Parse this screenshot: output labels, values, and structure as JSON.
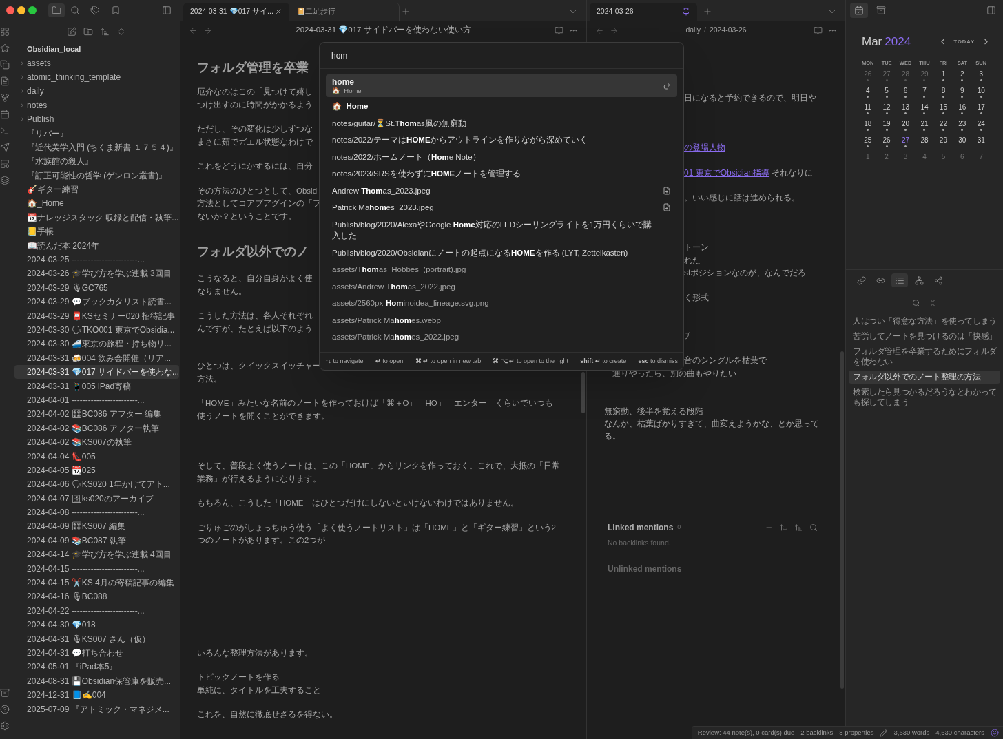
{
  "file_explorer": {
    "vault_name": "Obsidian_local",
    "items": [
      {
        "kind": "folder",
        "name": "assets",
        "selected": false
      },
      {
        "kind": "folder",
        "name": "atomic_thinking_template",
        "selected": false
      },
      {
        "kind": "folder",
        "name": "daily",
        "selected": false
      },
      {
        "kind": "folder",
        "name": "notes",
        "selected": false
      },
      {
        "kind": "folder",
        "name": "Publish",
        "selected": false
      },
      {
        "kind": "file",
        "name": "『リバー』",
        "selected": false
      },
      {
        "kind": "file",
        "name": "『近代美学入門 (ちくま新書 １７５４)』",
        "selected": false
      },
      {
        "kind": "file",
        "name": "『水族館の殺人』",
        "selected": false
      },
      {
        "kind": "file",
        "name": "『訂正可能性の哲学 (ゲンロン叢書)』",
        "selected": false
      },
      {
        "kind": "file",
        "name": "🎸ギター練習",
        "selected": false
      },
      {
        "kind": "file",
        "name": "🏠_Home",
        "selected": false
      },
      {
        "kind": "file",
        "name": "📆ナレッジスタック 収録と配信・執筆...",
        "selected": false
      },
      {
        "kind": "file",
        "name": "📒手帳",
        "selected": false
      },
      {
        "kind": "file",
        "name": "📖読んだ本 2024年",
        "selected": false
      },
      {
        "kind": "file",
        "name": "2024-03-25 ------------------------...",
        "selected": false
      },
      {
        "kind": "file",
        "name": "2024-03-26 🎓学び方を学ぶ連載 3回目",
        "selected": false
      },
      {
        "kind": "file",
        "name": "2024-03-29 🎙GC765",
        "selected": false
      },
      {
        "kind": "file",
        "name": "2024-03-29 💬ブックカタリスト読書...",
        "selected": false
      },
      {
        "kind": "file",
        "name": "2024-03-29 📮KSセミナー020 招待記事",
        "selected": false
      },
      {
        "kind": "file",
        "name": "2024-03-30 🗣TKO001 東京でObsidia...",
        "selected": false
      },
      {
        "kind": "file",
        "name": "2024-03-30 🚄東京の旅程・持ち物リ...",
        "selected": false
      },
      {
        "kind": "file",
        "name": "2024-03-31 🍻004 飲み会開催（リア...",
        "selected": false
      },
      {
        "kind": "file",
        "name": "2024-03-31 💎017 サイドバーを使わな...",
        "selected": true
      },
      {
        "kind": "file",
        "name": "2024-03-31 📱005 iPad寄稿",
        "selected": false
      },
      {
        "kind": "file",
        "name": "2024-04-01 ------------------------...",
        "selected": false
      },
      {
        "kind": "file",
        "name": "2024-04-02 🎛BC086 アフター 編集",
        "selected": false
      },
      {
        "kind": "file",
        "name": "2024-04-02 📚BC086 アフター執筆",
        "selected": false
      },
      {
        "kind": "file",
        "name": "2024-04-02 📚KS007の執筆",
        "selected": false
      },
      {
        "kind": "file",
        "name": "2024-04-04 👠005",
        "selected": false
      },
      {
        "kind": "file",
        "name": "2024-04-05 📆025",
        "selected": false
      },
      {
        "kind": "file",
        "name": "2024-04-06 🗣KS020 1年かけてアト...",
        "selected": false
      },
      {
        "kind": "file",
        "name": "2024-04-07 🗄ks020のアーカイブ",
        "selected": false
      },
      {
        "kind": "file",
        "name": "2024-04-08 ------------------------...",
        "selected": false
      },
      {
        "kind": "file",
        "name": "2024-04-09 🎛KS007 編集",
        "selected": false
      },
      {
        "kind": "file",
        "name": "2024-04-09 📚BC087 執筆",
        "selected": false
      },
      {
        "kind": "file",
        "name": "2024-04-14 🎓学び方を学ぶ連載 4回目",
        "selected": false
      },
      {
        "kind": "file",
        "name": "2024-04-15 ------------------------...",
        "selected": false
      },
      {
        "kind": "file",
        "name": "2024-04-15 ✂️KS 4月の寄稿記事の編集",
        "selected": false
      },
      {
        "kind": "file",
        "name": "2024-04-16 🎙BC088",
        "selected": false
      },
      {
        "kind": "file",
        "name": "2024-04-22 ------------------------...",
        "selected": false
      },
      {
        "kind": "file",
        "name": "2024-04-30 💎018",
        "selected": false
      },
      {
        "kind": "file",
        "name": "2024-04-31 🎙KS007 さん（仮）",
        "selected": false
      },
      {
        "kind": "file",
        "name": "2024-04-31 💬打ち合わせ",
        "selected": false
      },
      {
        "kind": "file",
        "name": "2024-05-01 『iPad本5』",
        "selected": false
      },
      {
        "kind": "file",
        "name": "2024-08-31 💾Obsidian保管庫を販売...",
        "selected": false
      },
      {
        "kind": "file",
        "name": "2024-12-31 📘✍️004",
        "selected": false
      },
      {
        "kind": "file",
        "name": "2025-07-09 『アトミック・マネジメ...",
        "selected": false
      }
    ]
  },
  "left_pane": {
    "tabs": [
      {
        "label": "2024-03-31 💎017 サイ...",
        "selected": true
      },
      {
        "label": "📔二足歩行",
        "selected": false
      }
    ],
    "title": "2024-03-31 💎017 サイドバーを使わない使い方",
    "content": [
      {
        "kind": "heading",
        "lines": [
          "フォルダ管理を卒業"
        ]
      },
      {
        "kind": "paragraph",
        "lines": [
          "厄介なのはこの「見つけて嬉し",
          "つけ出すのに時間がかかるよう"
        ]
      },
      {
        "kind": "paragraph",
        "lines": [
          "ただし、その変化は少しずつな",
          "まさに茹でガエル状態なわけで"
        ]
      },
      {
        "kind": "paragraph",
        "lines": [
          "これをどうにかするには、自分"
        ]
      },
      {
        "kind": "paragraph",
        "lines": [
          "その方法のひとつとして、Obsid",
          "方法としてコアプアグインの「フ",
          "ないか？ということです。"
        ]
      },
      {
        "kind": "heading",
        "lines": [
          "フォルダ以外でのノ"
        ]
      },
      {
        "kind": "paragraph",
        "lines": [
          "こうなると、自分自身がよく使",
          "なりません。"
        ]
      },
      {
        "kind": "paragraph",
        "lines": [
          "こうした方法は、各人それぞれ",
          "んですが、たとえば以下のよう"
        ]
      },
      {
        "kind": "paragraph",
        "lines": [
          "ひとつは、クイックスイッチャー",
          "方法。"
        ]
      },
      {
        "kind": "paragraph",
        "lines": [
          "「HOME」みたいな名前のノートを作っておけば「⌘＋O」「HO」「エンター」くらいでいつも",
          "使うノートを開くことができます。"
        ]
      },
      {
        "kind": "paragraph",
        "lines": [
          "そして、普段よく使うノートは、この「HOME」からリンクを作っておく。これで、大抵の「日常",
          "業務」が行えるようになります。"
        ]
      },
      {
        "kind": "paragraph",
        "lines": [
          "もちろん、こうした「HOME」はひとつだけにしないといけないわけではありません。"
        ]
      },
      {
        "kind": "paragraph",
        "lines": [
          "ごりゅごのがしょっちゅう使う「よく使うノートリスト」は「HOME」と「ギター練習」という2",
          "つのノートがあります。この2つが"
        ]
      },
      {
        "kind": "paragraph",
        "lines": [
          "いろんな整理方法があります。"
        ]
      },
      {
        "kind": "paragraph",
        "lines": [
          "トピックノートを作る",
          "単純に、タイトルを工夫すること"
        ]
      },
      {
        "kind": "paragraph",
        "lines": [
          "これを、自然に徹底せざるを得ない。"
        ]
      }
    ]
  },
  "right_pane": {
    "tabs": [
      {
        "label": "2024-03-26",
        "selected": true,
        "pinned": true
      }
    ],
    "breadcrumb": [
      "daily",
      "2024-03-26"
    ],
    "breadcrumb_separator": "/",
    "content": [
      {
        "kind": "fragment",
        "text": "日になると予約できるので、明日や"
      },
      {
        "kind": "fragment",
        "link": "の登場人物"
      },
      {
        "kind": "fragment",
        "link": "01 東京でObsidian指導",
        "text": " それなりに"
      },
      {
        "kind": "fragment",
        "text": "。いい感じに話は進められる。"
      },
      {
        "kind": "fragment",
        "text": "トーン"
      },
      {
        "kind": "fragment",
        "text": "れた"
      },
      {
        "kind": "fragment",
        "text": "stポジションなのが、なんでだろ"
      },
      {
        "kind": "fragment",
        "text": "く形式"
      },
      {
        "kind": "fragment",
        "text": "チ"
      },
      {
        "kind": "fragment",
        "text": "音のシングルを枯葉で"
      },
      {
        "kind": "line",
        "text": "一通りやったら、別の曲もやりたい"
      },
      {
        "kind": "line",
        "text": "無窮動、後半を覚える段階"
      },
      {
        "kind": "line",
        "text": "なんか、枯葉ばかりすぎて、曲変えようかな、とか思って"
      },
      {
        "kind": "line",
        "text": "る。"
      }
    ],
    "linked_mentions": {
      "title": "Linked mentions",
      "count": "0",
      "empty": "No backlinks found."
    },
    "unlinked_mentions": "Unlinked mentions"
  },
  "right_sidebar": {
    "calendar": {
      "month": "Mar",
      "year": "2024",
      "today_label": "TODAY",
      "weekdays": [
        "MON",
        "TUE",
        "WED",
        "THU",
        "FRI",
        "SAT",
        "SUN"
      ],
      "weeks": [
        [
          {
            "day": "26",
            "dim": true,
            "dot": true,
            "today": false
          },
          {
            "day": "27",
            "dim": true,
            "dot": true,
            "today": false
          },
          {
            "day": "28",
            "dim": true,
            "dot": true,
            "today": false
          },
          {
            "day": "29",
            "dim": true,
            "dot": true,
            "today": false
          },
          {
            "day": "1",
            "dim": false,
            "dot": true,
            "today": false
          },
          {
            "day": "2",
            "dim": false,
            "dot": true,
            "today": false
          },
          {
            "day": "3",
            "dim": false,
            "dot": true,
            "today": false
          }
        ],
        [
          {
            "day": "4",
            "dim": false,
            "dot": true,
            "today": false
          },
          {
            "day": "5",
            "dim": false,
            "dot": true,
            "today": false
          },
          {
            "day": "6",
            "dim": false,
            "dot": true,
            "today": false
          },
          {
            "day": "7",
            "dim": false,
            "dot": true,
            "today": false
          },
          {
            "day": "8",
            "dim": false,
            "dot": true,
            "today": false
          },
          {
            "day": "9",
            "dim": false,
            "dot": true,
            "today": false
          },
          {
            "day": "10",
            "dim": false,
            "dot": true,
            "today": false
          }
        ],
        [
          {
            "day": "11",
            "dim": false,
            "dot": true,
            "today": false
          },
          {
            "day": "12",
            "dim": false,
            "dot": true,
            "today": false
          },
          {
            "day": "13",
            "dim": false,
            "dot": true,
            "today": false
          },
          {
            "day": "14",
            "dim": false,
            "dot": true,
            "today": false
          },
          {
            "day": "15",
            "dim": false,
            "dot": true,
            "today": false
          },
          {
            "day": "16",
            "dim": false,
            "dot": true,
            "today": false
          },
          {
            "day": "17",
            "dim": false,
            "dot": true,
            "today": false
          }
        ],
        [
          {
            "day": "18",
            "dim": false,
            "dot": true,
            "today": false
          },
          {
            "day": "19",
            "dim": false,
            "dot": true,
            "today": false
          },
          {
            "day": "20",
            "dim": false,
            "dot": true,
            "today": false
          },
          {
            "day": "21",
            "dim": false,
            "dot": true,
            "today": false
          },
          {
            "day": "22",
            "dim": false,
            "dot": true,
            "today": false
          },
          {
            "day": "23",
            "dim": false,
            "dot": true,
            "today": false
          },
          {
            "day": "24",
            "dim": false,
            "dot": true,
            "today": false
          }
        ],
        [
          {
            "day": "25",
            "dim": false,
            "dot": true,
            "today": false
          },
          {
            "day": "26",
            "dim": false,
            "dot": true,
            "today": false
          },
          {
            "day": "27",
            "dim": false,
            "dot": true,
            "today": true
          },
          {
            "day": "28",
            "dim": false,
            "dot": false,
            "today": false
          },
          {
            "day": "29",
            "dim": false,
            "dot": false,
            "today": false
          },
          {
            "day": "30",
            "dim": false,
            "dot": false,
            "today": false
          },
          {
            "day": "31",
            "dim": false,
            "dot": false,
            "today": false
          }
        ],
        [
          {
            "day": "1",
            "dim": true,
            "dot": false,
            "today": false
          },
          {
            "day": "2",
            "dim": true,
            "dot": false,
            "today": false
          },
          {
            "day": "3",
            "dim": true,
            "dot": false,
            "today": false
          },
          {
            "day": "4",
            "dim": true,
            "dot": false,
            "today": false
          },
          {
            "day": "5",
            "dim": true,
            "dot": false,
            "today": false
          },
          {
            "day": "6",
            "dim": true,
            "dot": false,
            "today": false
          },
          {
            "day": "7",
            "dim": true,
            "dot": false,
            "today": false
          }
        ]
      ]
    },
    "panel_tabs": [
      {
        "kind": "backlinks",
        "selected": false
      },
      {
        "kind": "outgoing",
        "selected": false
      },
      {
        "kind": "outline",
        "selected": true
      },
      {
        "kind": "tree",
        "selected": false
      },
      {
        "kind": "graph",
        "selected": false
      }
    ],
    "outline": [
      {
        "text": "人はつい「得意な方法」を使ってしまう",
        "selected": false
      },
      {
        "text": "苦労してノートを見つけるのは「快感」",
        "selected": false
      },
      {
        "text": "フォルダ管理を卒業するためにフォルダを使わない",
        "selected": false
      },
      {
        "text": "フォルダ以外でのノート整理の方法",
        "selected": true
      },
      {
        "text": "検索したら見つかるだろうなとわかっても探してしまう",
        "selected": false
      }
    ]
  },
  "quick_switcher": {
    "query": "hom",
    "results": [
      {
        "kind": "alias",
        "text": "home",
        "sub": "🏠_Home",
        "selected": true
      },
      {
        "kind": "note",
        "text": "🏠_**Home**",
        "selected": false
      },
      {
        "kind": "note",
        "text": "notes/guitar/⏳St.**Thom**as風の無窮動",
        "selected": false
      },
      {
        "kind": "note",
        "text": "notes/2022/テーマは**HOME**からアウトラインを作りながら深めていく",
        "selected": false
      },
      {
        "kind": "note",
        "text": "notes/2022/ホームノート（**Hom**e Note）",
        "selected": false
      },
      {
        "kind": "note",
        "text": "notes/2023/SRSを使わずに**HOME**ノートを管理する",
        "selected": false
      },
      {
        "kind": "unresolved",
        "text": "Andrew **Thom**as_2023.jpeg",
        "selected": false
      },
      {
        "kind": "unresolved",
        "text": "Patrick Ma**hom**es_2023.jpeg",
        "selected": false
      },
      {
        "kind": "note",
        "text": "Publish/blog/2020/AlexaやGoogle **Home**対応のLEDシーリングライトを1万円くらいで購入した",
        "selected": false
      },
      {
        "kind": "note",
        "text": "Publish/blog/2020/Obsidianにノートの起点になる**HOME**を作る (LYT, Zettelkasten)",
        "selected": false
      },
      {
        "kind": "attachment",
        "text": "assets/T**hom**as_Hobbes_(portrait).jpg",
        "selected": false
      },
      {
        "kind": "attachment",
        "text": "assets/Andrew T**hom**as_2022.jpeg",
        "selected": false
      },
      {
        "kind": "attachment",
        "text": "assets/2560px-**Hom**inoidea_lineage.svg.png",
        "selected": false
      },
      {
        "kind": "attachment",
        "text": "assets/Patrick Ma**hom**es.webp",
        "selected": false
      },
      {
        "kind": "attachment",
        "text": "assets/Patrick Ma**hom**es_2022.jpeg",
        "selected": false
      }
    ],
    "hints": [
      {
        "keys": "↑↓",
        "action": "to navigate"
      },
      {
        "keys": "↵",
        "action": "to open"
      },
      {
        "keys": "⌘ ↵",
        "action": "to open in new tab"
      },
      {
        "keys": "⌘ ⌥ ↵",
        "action": "to open to the right"
      },
      {
        "keys": "shift ↵",
        "action": "to create"
      },
      {
        "keys": "esc",
        "action": "to dismiss"
      }
    ]
  },
  "status_bar": {
    "review": "Review: 44 note(s), 0 card(s) due",
    "backlinks": "2 backlinks",
    "properties": "8 properties",
    "words": "3,630 words",
    "characters": "4,630 characters"
  }
}
